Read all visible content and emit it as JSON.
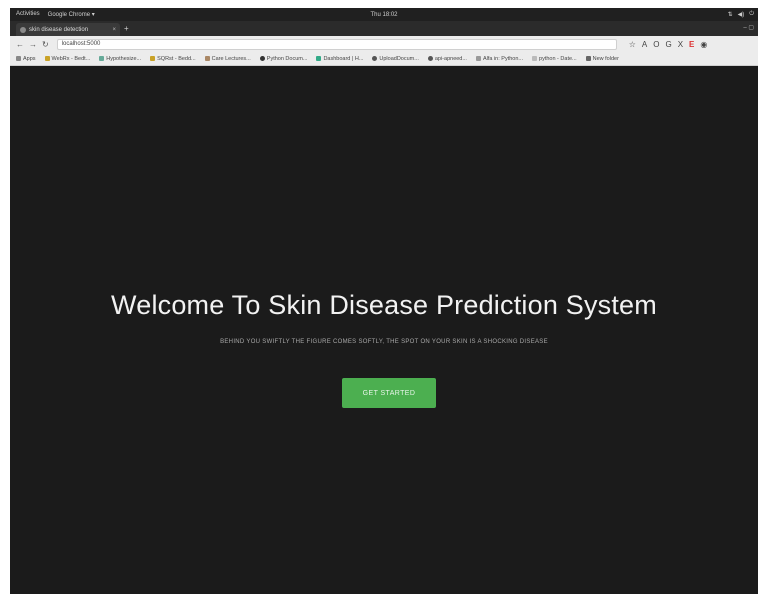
{
  "os_bar": {
    "activities": "Activities",
    "app_menu": "Google Chrome ▾",
    "clock": "Thu 18:02",
    "tray": [
      "⇅",
      "◀)",
      "⏻"
    ]
  },
  "browser": {
    "tab_title": "skin disease detection",
    "tab_close": "×",
    "new_tab": "+",
    "url": "localhost:5000",
    "nav": {
      "back": "←",
      "forward": "→",
      "reload": "↻"
    },
    "extensions": [
      "☆",
      "A",
      "O",
      "G",
      "X",
      "E",
      "◉"
    ],
    "bookmarks": [
      "Apps",
      "WebRx - Bedt...",
      "Hypothesize...",
      "SQRst - Bedd...",
      "Care Lectures...",
      "Python Docum...",
      "Dashboard | H...",
      "UploadDocum...",
      "api-apneed...",
      "Alfa in: Python...",
      "python - Date...",
      "New folder"
    ]
  },
  "hero": {
    "title": "Welcome To Skin Disease Prediction System",
    "subtitle": "BEHIND YOU SWIFTLY THE FIGURE COMES SOFTLY, THE SPOT ON YOUR SKIN IS A SHOCKING DISEASE",
    "cta_label": "GET STARTED"
  },
  "colors": {
    "page_background": "#1b1b1b",
    "cta_background": "#4caf50"
  }
}
